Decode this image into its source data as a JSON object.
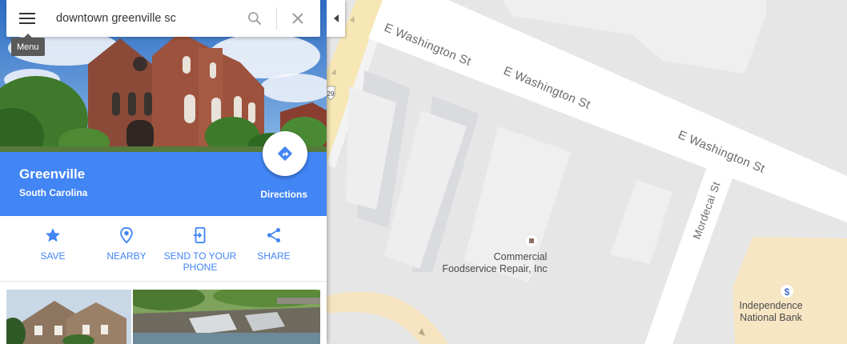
{
  "search": {
    "value": "downtown greenville sc",
    "menu_tooltip": "Menu"
  },
  "place": {
    "name": "Greenville",
    "region": "South Carolina",
    "directions_label": "Directions"
  },
  "actions": [
    {
      "label": "SAVE",
      "icon": "star-icon"
    },
    {
      "label": "NEARBY",
      "icon": "location-pin-icon"
    },
    {
      "label": "SEND TO YOUR PHONE",
      "icon": "send-to-phone-icon"
    },
    {
      "label": "SHARE",
      "icon": "share-icon"
    }
  ],
  "map": {
    "streets": [
      {
        "name": "E Washington St"
      },
      {
        "name": "E Washington St"
      },
      {
        "name": "E Washington St"
      },
      {
        "name": "Mordecai St"
      }
    ],
    "pois": [
      {
        "name_line1": "Commercial",
        "name_line2": "Foodservice Repair, Inc",
        "icon": "business-marker-icon"
      },
      {
        "name_line1": "Independence",
        "name_line2": "National Bank",
        "icon": "bank-dollar-icon"
      }
    ],
    "highway_shield": "29",
    "colors": {
      "background": "#e6e6e6",
      "road": "#ffffff",
      "building": "#f1f1f1",
      "highlighted_area": "#fdf0c8",
      "bank_lot": "#f7e6c4"
    }
  },
  "theme": {
    "accent": "#4285f4"
  }
}
